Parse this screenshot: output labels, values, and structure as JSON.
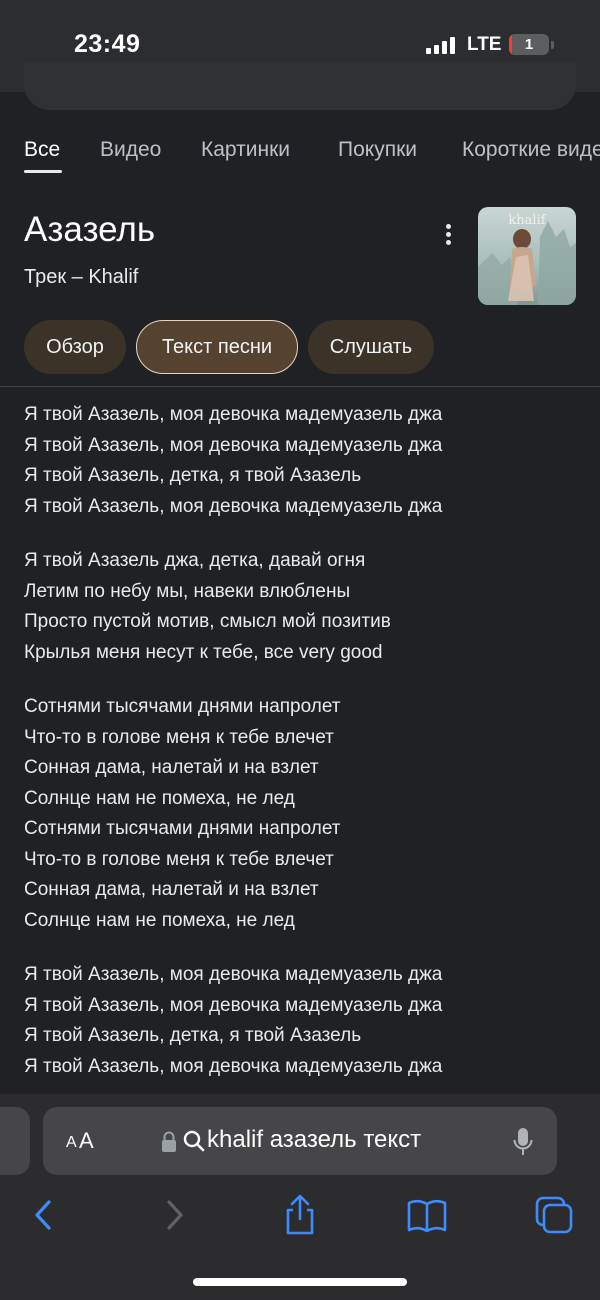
{
  "status_bar": {
    "time": "23:49",
    "network": "LTE",
    "battery_level": "1",
    "battery_fraction": 0.05
  },
  "tabs": [
    {
      "label": "Все",
      "active": true
    },
    {
      "label": "Видео",
      "active": false
    },
    {
      "label": "Картинки",
      "active": false
    },
    {
      "label": "Покупки",
      "active": false
    },
    {
      "label": "Короткие видео",
      "active": false
    }
  ],
  "knowledge_panel": {
    "title": "Азазель",
    "subtitle": "Трек – Khalif",
    "album_art_label": "khalif",
    "chips": [
      {
        "label": "Обзор",
        "selected": false
      },
      {
        "label": "Текст песни",
        "selected": true
      },
      {
        "label": "Слушать",
        "selected": false
      }
    ]
  },
  "lyrics": [
    [
      "Я твой Азазель, моя девочка мадемуазель джа",
      "Я твой Азазель, моя девочка мадемуазель джа",
      "Я твой Азазель, детка, я твой Азазель",
      "Я твой Азазель, моя девочка мадемуазель джа"
    ],
    [
      "Я твой Азазель джа, детка, давай огня",
      "Летим по небу мы, навеки влюблены",
      "Просто пустой мотив, смысл мой позитив",
      "Крылья меня несут к тебе, все very good"
    ],
    [
      "Сотнями тысячами днями напролет",
      "Что-то в голове меня к тебе влечет",
      "Сонная дама, налетай и на взлет",
      "Солнце нам не помеха, не лед",
      "Сотнями тысячами днями напролет",
      "Что-то в голове меня к тебе влечет",
      "Сонная дама, налетай и на взлет",
      "Солнце нам не помеха, не лед"
    ],
    [
      "Я твой Азазель, моя девочка мадемуазель джа",
      "Я твой Азазель, моя девочка мадемуазель джа",
      "Я твой Азазель, детка, я твой Азазель",
      "Я твой Азазель, моя девочка мадемуазель джа"
    ]
  ],
  "browser": {
    "aa_small": "A",
    "aa_big": "A",
    "address": "khalif азазель текст",
    "icons": [
      "lock-icon",
      "search-icon",
      "mic-icon",
      "back-icon",
      "forward-icon",
      "share-icon",
      "bookmarks-icon",
      "tabs-icon"
    ]
  },
  "colors": {
    "background": "#202124",
    "chip": "#3b3328",
    "chip_selected": "#56432f",
    "accent_blue": "#3d8bfd"
  }
}
